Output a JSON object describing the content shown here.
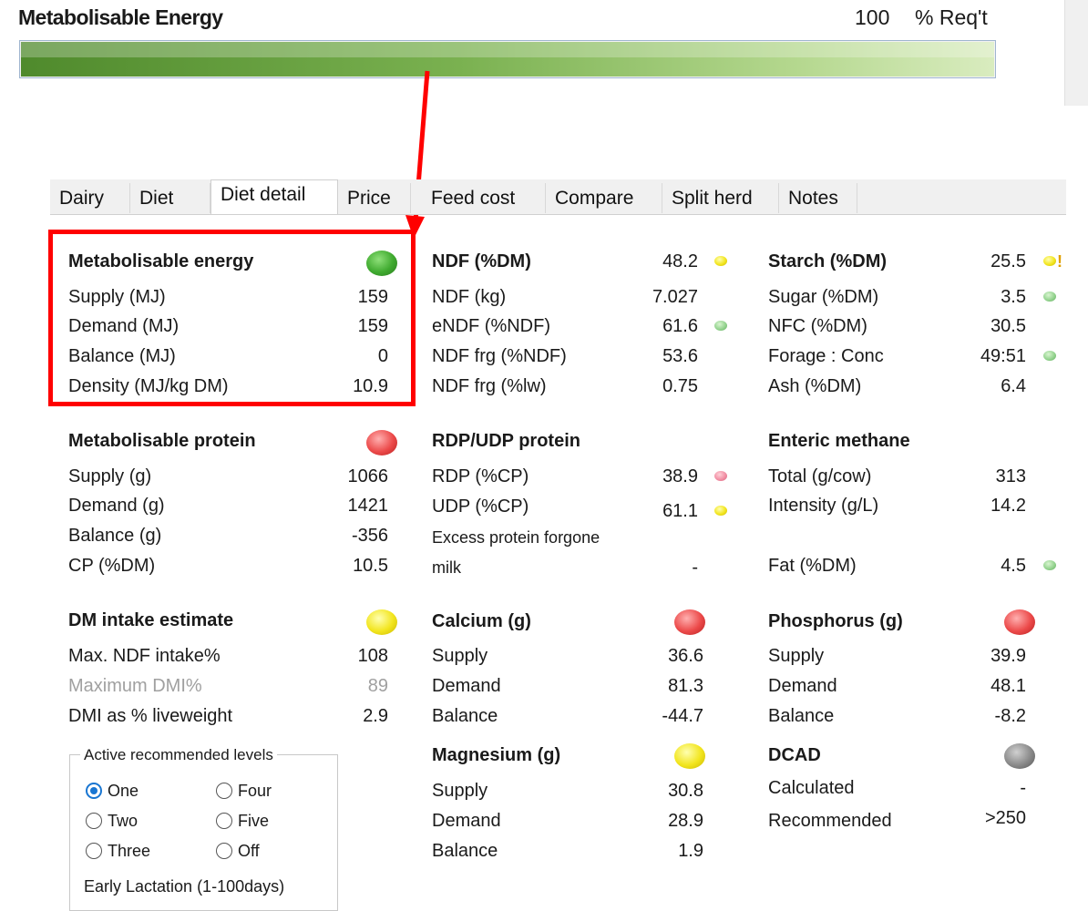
{
  "top": {
    "title": "Metabolisable Energy",
    "value": "100",
    "unit": "% Req't",
    "progress_percent": 100
  },
  "tabs": [
    "Dairy",
    "Diet",
    "Diet detail",
    "Price",
    "Feed cost",
    "Compare",
    "Split herd",
    "Notes"
  ],
  "active_tab": "Diet detail",
  "me": {
    "title": "Metabolisable energy",
    "status": "green",
    "rows": [
      {
        "label": "Supply (MJ)",
        "value": "159"
      },
      {
        "label": "Demand (MJ)",
        "value": "159"
      },
      {
        "label": "Balance (MJ)",
        "value": "0"
      },
      {
        "label": "Density (MJ/kg DM)",
        "value": "10.9"
      }
    ]
  },
  "mp": {
    "title": "Metabolisable protein",
    "status": "red",
    "rows": [
      {
        "label": "Supply (g)",
        "value": "1066"
      },
      {
        "label": "Demand (g)",
        "value": "1421"
      },
      {
        "label": "Balance (g)",
        "value": "-356"
      },
      {
        "label": "CP (%DM)",
        "value": "10.5"
      }
    ]
  },
  "dmi": {
    "title": "DM intake estimate",
    "status": "yellow",
    "rows": [
      {
        "label": "Max. NDF intake%",
        "value": "108"
      },
      {
        "label": "Maximum DMI%",
        "value": "89"
      },
      {
        "label": "DMI as % liveweight",
        "value": "2.9"
      }
    ]
  },
  "levels": {
    "title": "Active recommended levels",
    "options": [
      "One",
      "Two",
      "Three",
      "Four",
      "Five",
      "Off"
    ],
    "selected": "One",
    "stage": "Early Lactation (1-100days)"
  },
  "ndf": {
    "title": "NDF (%DM)",
    "value": "48.2",
    "status": "yellow",
    "rows": [
      {
        "label": "NDF (kg)",
        "value": "7.027"
      },
      {
        "label": "eNDF (%NDF)",
        "value": "61.6",
        "status": "green"
      },
      {
        "label": "NDF frg (%NDF)",
        "value": "53.6"
      },
      {
        "label": "NDF frg (%lw)",
        "value": "0.75"
      }
    ]
  },
  "rdp": {
    "title": "RDP/UDP protein",
    "rows": [
      {
        "label": "RDP (%CP)",
        "value": "38.9",
        "status": "pink"
      },
      {
        "label": "UDP (%CP)",
        "value": "61.1",
        "status": "yellow"
      },
      {
        "label": "Excess protein forgone",
        "value": ""
      },
      {
        "label": "milk",
        "value": "-"
      }
    ]
  },
  "calcium": {
    "title": "Calcium (g)",
    "status": "red",
    "rows": [
      {
        "label": "Supply",
        "value": "36.6"
      },
      {
        "label": "Demand",
        "value": "81.3"
      },
      {
        "label": "Balance",
        "value": "-44.7"
      }
    ]
  },
  "magnesium": {
    "title": "Magnesium (g)",
    "status": "yellow",
    "rows": [
      {
        "label": "Supply",
        "value": "30.8"
      },
      {
        "label": "Demand",
        "value": "28.9"
      },
      {
        "label": "Balance",
        "value": "1.9"
      }
    ]
  },
  "starch": {
    "title": "Starch (%DM)",
    "value": "25.5",
    "status": "yellow",
    "flag": "!",
    "rows": [
      {
        "label": "Sugar (%DM)",
        "value": "3.5",
        "status": "green"
      },
      {
        "label": "NFC (%DM)",
        "value": "30.5"
      },
      {
        "label": "Forage : Conc",
        "value": "49:51",
        "status": "green"
      },
      {
        "label": "Ash (%DM)",
        "value": "6.4"
      }
    ]
  },
  "methane": {
    "title": "Enteric methane",
    "rows": [
      {
        "label": "Total (g/cow)",
        "value": "313"
      },
      {
        "label": "Intensity (g/L)",
        "value": "14.2"
      }
    ]
  },
  "fat": {
    "label": "Fat (%DM)",
    "value": "4.5",
    "status": "green"
  },
  "phosphorus": {
    "title": "Phosphorus (g)",
    "status": "red",
    "rows": [
      {
        "label": "Supply",
        "value": "39.9"
      },
      {
        "label": "Demand",
        "value": "48.1"
      },
      {
        "label": "Balance",
        "value": "-8.2"
      }
    ]
  },
  "dcad": {
    "title": "DCAD",
    "status": "grey",
    "rows": [
      {
        "label": "Calculated",
        "value": "-"
      },
      {
        "label": "Recommended",
        "value": ">250"
      }
    ]
  },
  "colors": {
    "highlight": "#ff0000",
    "progress": "#7ab150",
    "radio_selected": "#1976d2"
  }
}
